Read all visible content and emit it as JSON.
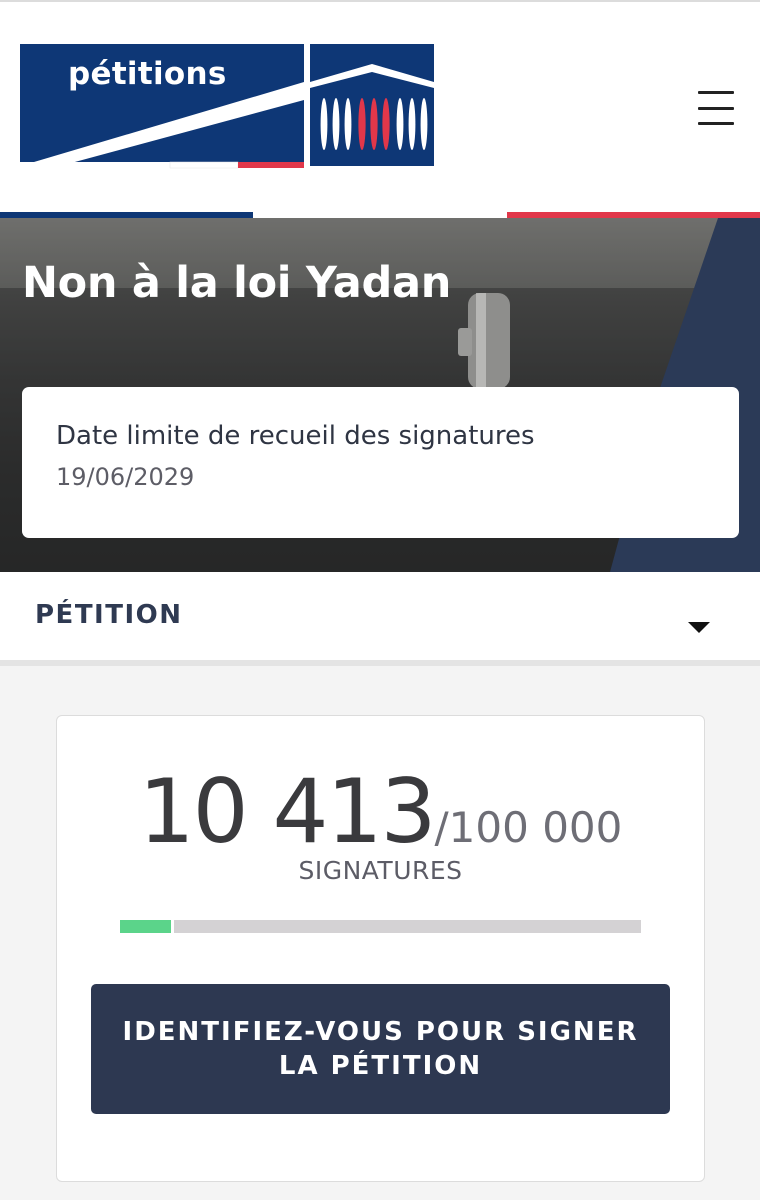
{
  "header": {
    "logo_text": "pétitions",
    "menu_icon": "hamburger-menu-icon"
  },
  "colors": {
    "navy": "#0e3776",
    "republic_red": "#e1374a",
    "button_navy": "#2d3851",
    "progress_green": "#5bd48a"
  },
  "hero": {
    "title": "Non à la loi Yadan",
    "deadline_label": "Date limite de recueil des signatures",
    "deadline_date": "19/06/2029"
  },
  "section": {
    "title": "PÉTITION",
    "toggle_icon": "caret-down-icon"
  },
  "signatures": {
    "current": "10 413",
    "goal": "/100 000",
    "unit": "SIGNATURES",
    "progress_fraction": 0.104
  },
  "cta": {
    "label": "IDENTIFIEZ-VOUS POUR SIGNER LA PÉTITION"
  }
}
